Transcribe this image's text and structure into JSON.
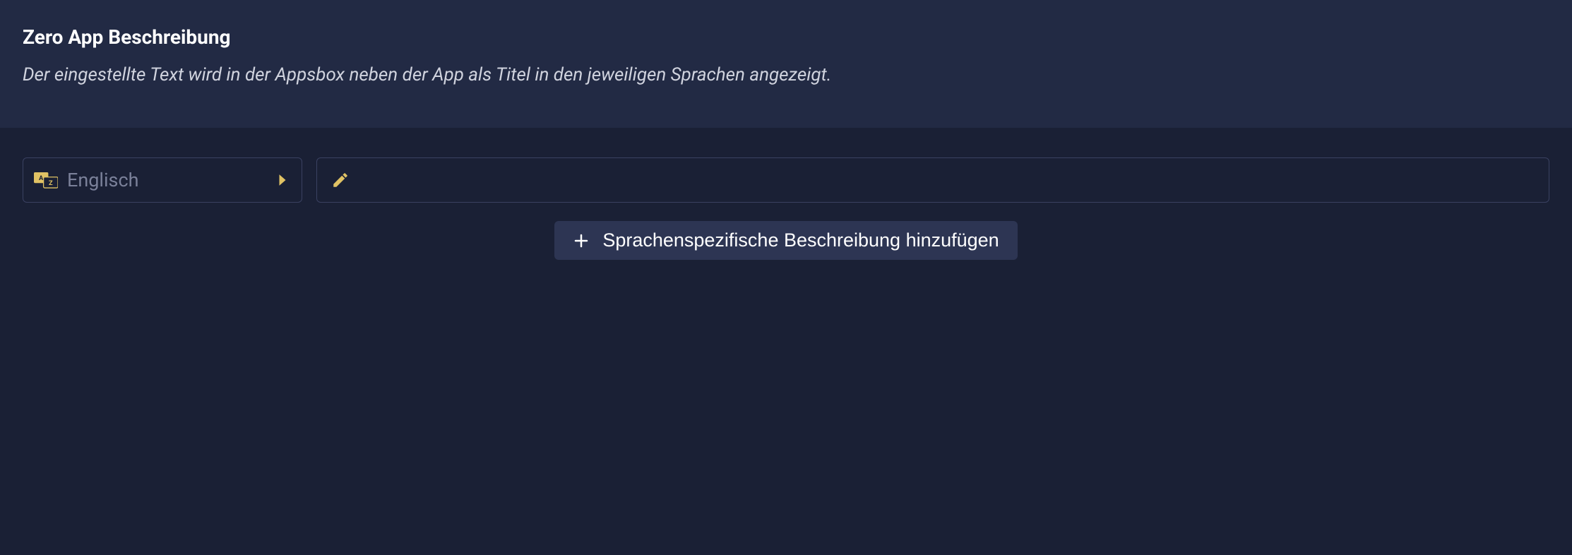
{
  "header": {
    "title": "Zero App Beschreibung",
    "subtitle": "Der eingestellte Text wird in der Appsbox neben der App als Titel in den jeweiligen Sprachen angezeigt."
  },
  "row": {
    "language_label": "Englisch",
    "description_value": ""
  },
  "add_button": {
    "label": "Sprachenspezifische Beschreibung hinzufügen"
  }
}
